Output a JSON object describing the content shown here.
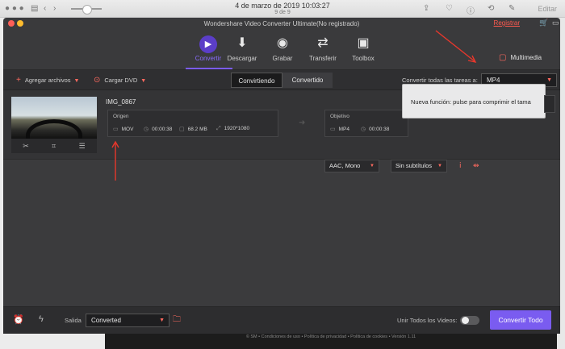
{
  "viewer": {
    "date": "4 de marzo de 2019 10:03:27",
    "count": "9 de 9",
    "edit_label": "Editar",
    "back_icon": "chevron-left",
    "forward_icon": "chevron-right",
    "info_icon": "info"
  },
  "app": {
    "title": "Wondershare Video Converter Ultimate(No registrado)",
    "register_label": "Registrar",
    "cart_icon": "cart",
    "message_icon": "speech-bubble"
  },
  "nav": [
    {
      "label": "Convertir",
      "icon": "play",
      "glyph": "▶",
      "active": true
    },
    {
      "label": "Descargar",
      "icon": "download",
      "glyph": "⬇",
      "active": false
    },
    {
      "label": "Grabar",
      "icon": "disc",
      "glyph": "◉",
      "active": false
    },
    {
      "label": "Transferir",
      "icon": "transfer",
      "glyph": "⇄",
      "active": false
    },
    {
      "label": "Toolbox",
      "icon": "toolbox",
      "glyph": "▣",
      "active": false
    }
  ],
  "multimedia_label": "Multimedia",
  "toolbar": {
    "add_files": "Agregar archivos",
    "load_dvd": "Cargar DVD",
    "tab_converting": "Convirtiendo",
    "tab_converted": "Convertido",
    "convert_all_label": "Convertir todas las tareas a:",
    "format": "MP4"
  },
  "file": {
    "name": "IMG_0867",
    "source": {
      "title": "Origen",
      "format": "MOV",
      "duration": "00:00:38",
      "size": "68.2 MB",
      "resolution": "1920*1080"
    },
    "target": {
      "title": "Objetivo",
      "format": "MP4",
      "duration": "00:00:38"
    },
    "audio": "AAC, Mono",
    "subtitles": "Sin subtítulos"
  },
  "tooltip": "Nueva función: pulse para comprimir el tama",
  "bottom": {
    "output_label": "Salida",
    "output_value": "Converted",
    "merge_label": "Unir Todos los Videos:",
    "convert_all_button": "Convertir Todo"
  },
  "footer": {
    "line1": "© SM • Condiciones de uso • Política de privacidad • Política de cookies • Versión 1.11"
  },
  "colors": {
    "accent": "#7a5cf0",
    "red": "#ff5a4f",
    "annotation": "#e8372c"
  }
}
